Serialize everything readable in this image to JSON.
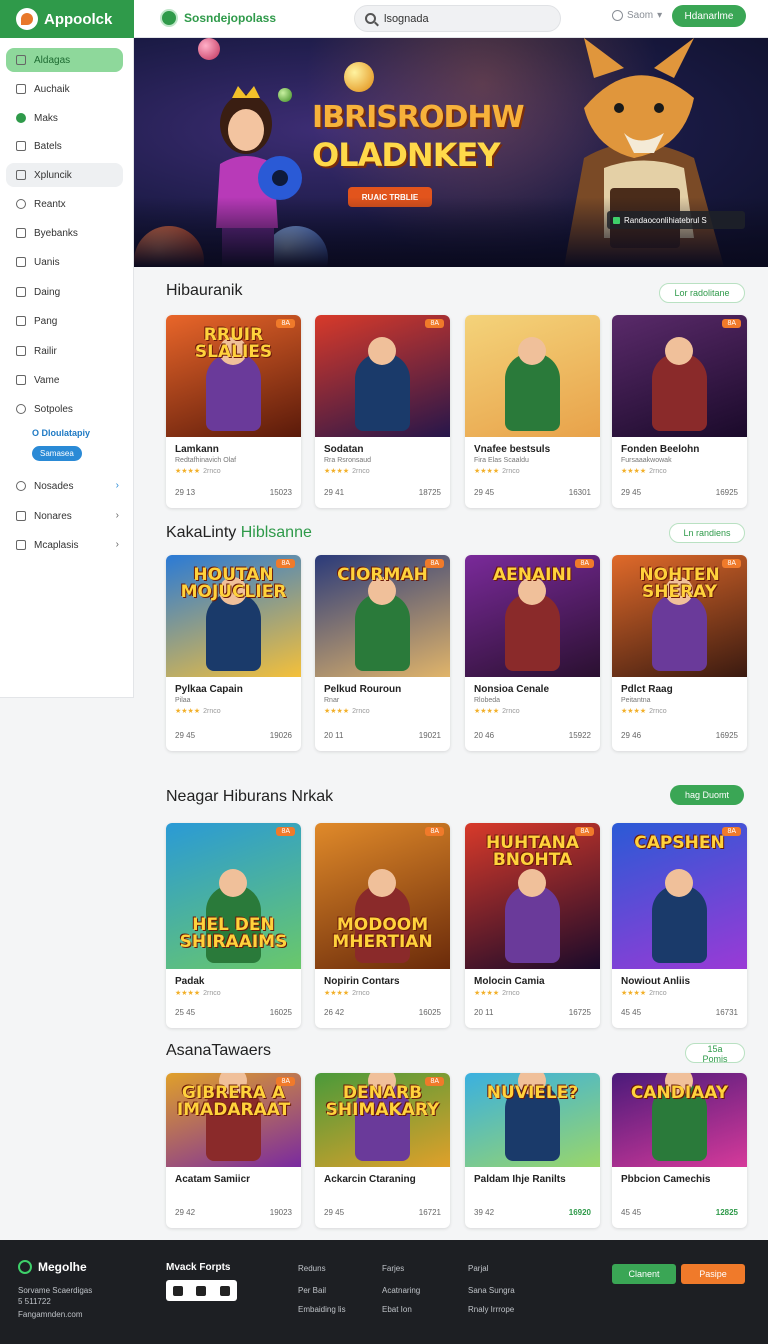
{
  "header": {
    "brand": "Appoolck",
    "sub_brand": "Sosndejopolass",
    "search_value": "lsognada",
    "user_label": "Saom",
    "cta_label": "Hdanarlme"
  },
  "sidebar": {
    "items": [
      {
        "label": "Aldagas"
      },
      {
        "label": "Auchaik"
      },
      {
        "label": "Maks"
      },
      {
        "label": "Batels"
      },
      {
        "label": "Xpluncik"
      },
      {
        "label": "Reantx"
      },
      {
        "label": "Byebanks"
      },
      {
        "label": "Uanis"
      },
      {
        "label": "Daing"
      },
      {
        "label": "Pang"
      },
      {
        "label": "Railir"
      },
      {
        "label": "Vame"
      },
      {
        "label": "Sotpoles"
      }
    ],
    "sub_link": "O Dloulatapiy",
    "sub_pill": "Samasea",
    "bottom_items": [
      {
        "label": "Nosades"
      },
      {
        "label": "Nonares"
      },
      {
        "label": "Mcaplasis"
      }
    ]
  },
  "hero": {
    "title_1": "IBRISRODHW",
    "title_2": "OLADNKEY",
    "button": "RUAIC TRBLIE",
    "badge": "Randaoconlihiatebrul S"
  },
  "sections": [
    {
      "title": "Hibauranik",
      "button": "Lor radolitane",
      "cards": [
        {
          "art": "RRUIR SLALIES",
          "tag": "8A",
          "title": "Lamkann",
          "sub": "Redtafhinavich Olaf",
          "stars": "★★★★",
          "rating": "2rnco",
          "left": "29 13",
          "right": "15023"
        },
        {
          "art": "",
          "tag": "8A",
          "title": "Sodatan",
          "sub": "Rra Rsronsaud",
          "stars": "★★★★",
          "rating": "2rnco",
          "left": "29 41",
          "right": "18725"
        },
        {
          "art": "",
          "tag": "",
          "title": "Vnafee bestsuls",
          "sub": "Fira Elas Scaaldu",
          "stars": "★★★★",
          "rating": "2rnco",
          "left": "29 45",
          "right": "16301"
        },
        {
          "art": "",
          "tag": "8A",
          "title": "Fonden Beelohn",
          "sub": "Fursaaakwowak",
          "stars": "★★★★",
          "rating": "2rnco",
          "left": "29 45",
          "right": "16925"
        }
      ]
    },
    {
      "title": "KakaLinty",
      "title_accent": "Hiblsanne",
      "button": "Ln randiens",
      "cards": [
        {
          "art": "HOUTAN MOJUCLIER",
          "tag": "8A",
          "title": "Pylkaa Capain",
          "sub": "Pilaa",
          "stars": "★★★★",
          "rating": "2rnco",
          "left": "29 45",
          "right": "19026"
        },
        {
          "art": "CIORMAH",
          "tag": "8A",
          "title": "Pelkud Rouroun",
          "sub": "Rnar",
          "stars": "★★★★",
          "rating": "2rnco",
          "left": "20 11",
          "right": "19021"
        },
        {
          "art": "AENAINI",
          "tag": "8A",
          "title": "Nonsioa Cenale",
          "sub": "Rlobeda",
          "stars": "★★★★",
          "rating": "2rnco",
          "left": "20 46",
          "right": "15922"
        },
        {
          "art": "NOHTEN SHERAY",
          "tag": "8A",
          "title": "Pdlct Raag",
          "sub": "Peitantna",
          "stars": "★★★★",
          "rating": "2rnco",
          "left": "29 46",
          "right": "16925"
        }
      ]
    },
    {
      "title": "Neagar Hiburans Nrkak",
      "button": "hag Duomt",
      "cards": [
        {
          "art": "HEL DEN SHIRAAIMS",
          "tag": "8A",
          "title": "Padak",
          "sub": "",
          "stars": "★★★★",
          "rating": "2rnco",
          "left": "25 45",
          "right": "16025"
        },
        {
          "art": "MODOOM MHERTIAN",
          "tag": "8A",
          "title": "Nopirin Contars",
          "sub": "",
          "stars": "★★★★",
          "rating": "2rnco",
          "left": "26 42",
          "right": "16025"
        },
        {
          "art": "HUHTANA BNOHTA",
          "tag": "8A",
          "title": "Molocin Camia",
          "sub": "",
          "stars": "★★★★",
          "rating": "2rnco",
          "left": "20 11",
          "right": "16725"
        },
        {
          "art": "CAPSHEN",
          "tag": "8A",
          "title": "Nowiout Anliis",
          "sub": "",
          "stars": "★★★★",
          "rating": "2rnco",
          "left": "45 45",
          "right": "16731"
        }
      ]
    },
    {
      "title": "AsanaTawaers",
      "button": "15a Pomis",
      "cards": [
        {
          "art": "GIBRERA A IMADARAAT",
          "tag": "8A",
          "title": "Acatam Samiicr",
          "sub": "",
          "stars": "",
          "rating": "",
          "left": "29 42",
          "right": "19023"
        },
        {
          "art": "DENARB SHIMAKARY",
          "tag": "8A",
          "title": "Ackarcin Ctaraning",
          "sub": "",
          "stars": "",
          "rating": "",
          "left": "29 45",
          "right": "16721"
        },
        {
          "art": "NUVIELE?",
          "tag": "",
          "title": "Paldam Ihje Ranilts",
          "sub": "",
          "stars": "",
          "rating": "",
          "left": "39 42",
          "right": "16920"
        },
        {
          "art": "CANDIAAY",
          "tag": "",
          "title": "Pbbcion Camechis",
          "sub": "",
          "stars": "",
          "rating": "",
          "left": "45 45",
          "right": "12825"
        }
      ]
    }
  ],
  "footer": {
    "brand": "Megolhe",
    "lines": [
      "Sorvame Scaerdigas",
      "5 511722",
      "Fangamnden.com"
    ],
    "social_head": "Mvack Forpts",
    "col1": [
      "Reduns",
      "Per Bail",
      "Embaiding lis"
    ],
    "col2": [
      "Farjes",
      "Acatnaring",
      "Ebat Ion"
    ],
    "col3": [
      "Parjal",
      "Sana Sungra",
      "Rnaly Irrrope"
    ],
    "btn_green": "Clanent",
    "btn_orange": "Pasipe"
  },
  "colors": {
    "brand_green": "#2f9a4a",
    "accent_orange": "#f07a2a",
    "accent_blue": "#2a8ad6"
  }
}
